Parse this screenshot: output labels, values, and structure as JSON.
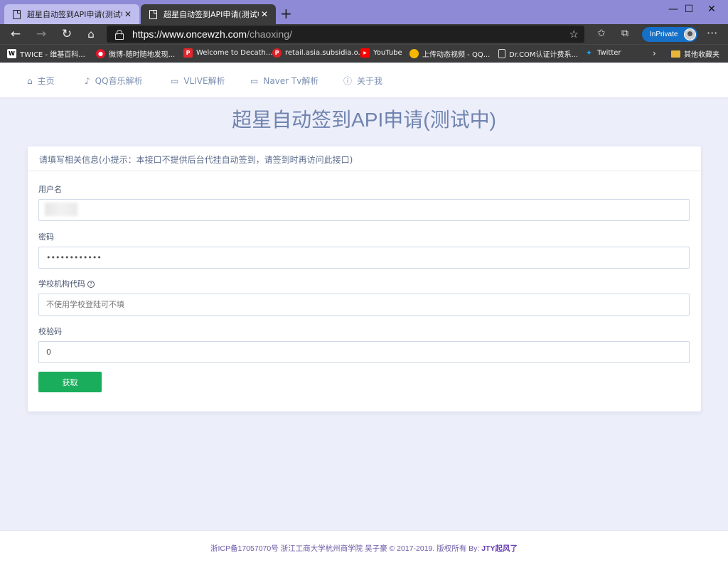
{
  "browser": {
    "tabs": [
      {
        "title": "超星自动签到API申请(测试中)",
        "active": false
      },
      {
        "title": "超星自动签到API申请(测试中)",
        "active": true
      }
    ],
    "url_host": "https://www.oncewzh.com",
    "url_path": "/chaoxing/",
    "inprivate_label": "InPrivate",
    "bookmarks": [
      {
        "label": "TWICE - 维基百科...",
        "icon": "wikipedia-icon",
        "color": "#ffffff"
      },
      {
        "label": "微博-随时随地发现...",
        "icon": "weibo-icon",
        "color": "#e6162d"
      },
      {
        "label": "Welcome to Decath...",
        "icon": "decathlon-icon",
        "color": "#e5262c"
      },
      {
        "label": "retail.asia.subsidia.o...",
        "icon": "retail-icon",
        "color": "#e01f26"
      },
      {
        "label": "YouTube",
        "icon": "youtube-icon",
        "color": "#ff0000"
      },
      {
        "label": "上传动态视频 - QQ...",
        "icon": "qq-icon",
        "color": "#f5b700"
      },
      {
        "label": "Dr.COM认证计费系...",
        "icon": "page-icon",
        "color": "#ffffff"
      },
      {
        "label": "Twitter",
        "icon": "twitter-icon",
        "color": "#1da1f2"
      }
    ],
    "other_bookmarks": "其他收藏夹"
  },
  "nav": {
    "items": [
      {
        "label": "主页",
        "icon": "home-icon"
      },
      {
        "label": "QQ音乐解析",
        "icon": "music-icon"
      },
      {
        "label": "VLIVE解析",
        "icon": "video-icon"
      },
      {
        "label": "Naver Tv解析",
        "icon": "video-icon"
      },
      {
        "label": "关于我",
        "icon": "info-icon"
      }
    ]
  },
  "page": {
    "title": "超星自动签到API申请(测试中)",
    "card_header": "请填写相关信息(小提示：本接口不提供后台代挂自动签到，请签到时再访问此接口)",
    "fields": {
      "username": {
        "label": "用户名",
        "value": "13"
      },
      "password": {
        "label": "密码",
        "value": "••••••••••••"
      },
      "school_code": {
        "label": "学校机构代码",
        "placeholder": "不使用学校登陆可不填"
      },
      "captcha": {
        "label": "校验码",
        "value": "0"
      }
    },
    "submit_label": "获取"
  },
  "footer": {
    "icp": "浙ICP备17057070号",
    "org": "浙江工商大学杭州商学院 吴子豪",
    "copyright": "© 2017-2019. 版权所有 By:",
    "author": "JTY起风了"
  },
  "colors": {
    "accent": "#1aad5b",
    "title": "#6f83ad",
    "tabstrip": "#8e8ad6"
  }
}
